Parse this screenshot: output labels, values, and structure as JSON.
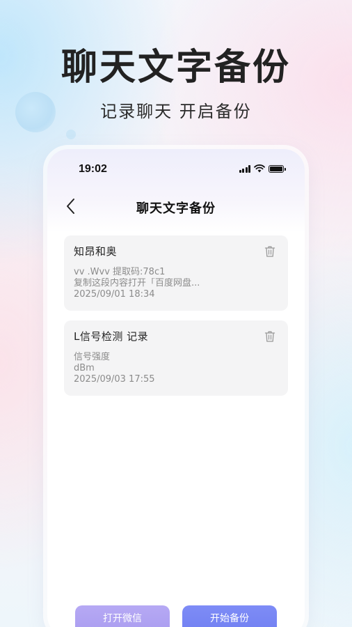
{
  "hero": {
    "title": "聊天文字备份",
    "subtitle": "记录聊天  开启备份"
  },
  "status_bar": {
    "time": "19:02"
  },
  "nav": {
    "title": "聊天文字备份"
  },
  "records": [
    {
      "title": "知昂和奥",
      "lines": [
        "vv .Wvv 提取码:78c1",
        "复制这段内容打开「百度网盘...",
        "2025/09/01 18:34"
      ]
    },
    {
      "title": "L信号检测 记录",
      "lines": [
        "信号强度",
        "dBm",
        "2025/09/03 17:55"
      ]
    }
  ],
  "actions": {
    "open_wechat": "打开微信",
    "start_backup": "开始备份"
  },
  "colors": {
    "open_wechat_button": "#ab9ef1",
    "start_backup_button": "#7584f3",
    "card_background": "#f4f4f5"
  },
  "icons": [
    "signal-icon",
    "wifi-icon",
    "battery-icon",
    "back-arrow-icon",
    "trash-icon"
  ]
}
